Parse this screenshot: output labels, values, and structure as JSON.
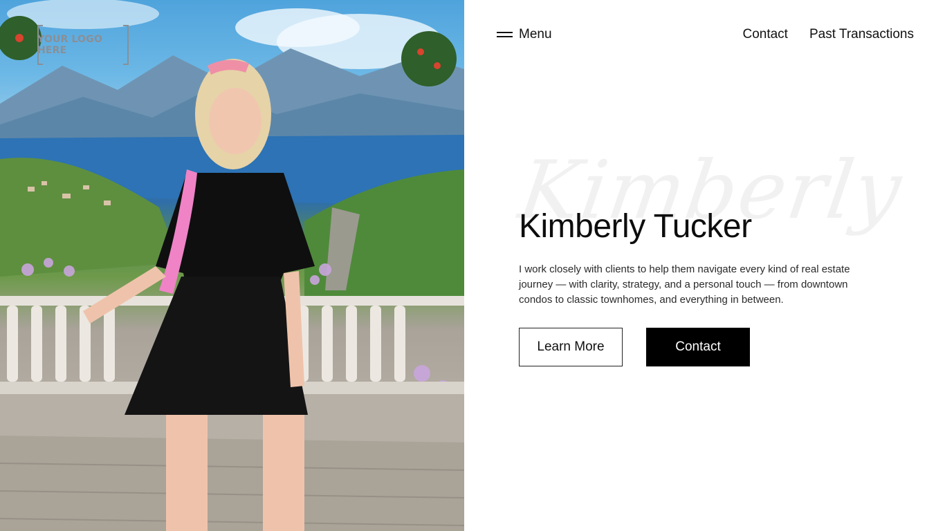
{
  "logo": {
    "text": "YOUR LOGO HERE"
  },
  "header": {
    "menu_label": "Menu",
    "nav": [
      {
        "label": "Contact"
      },
      {
        "label": "Past Transactions"
      }
    ]
  },
  "hero": {
    "script_name": "Kimberly",
    "title": "Kimberly Tucker",
    "description": "I work closely with clients to help them navigate every kind of real estate journey — with clarity, strategy, and a personal touch — from downtown condos to classic townhomes, and everything in between.",
    "buttons": {
      "learn_more": "Learn More",
      "contact": "Contact"
    }
  },
  "colors": {
    "text": "#111111",
    "button_solid_bg": "#000000",
    "background": "#ffffff"
  }
}
